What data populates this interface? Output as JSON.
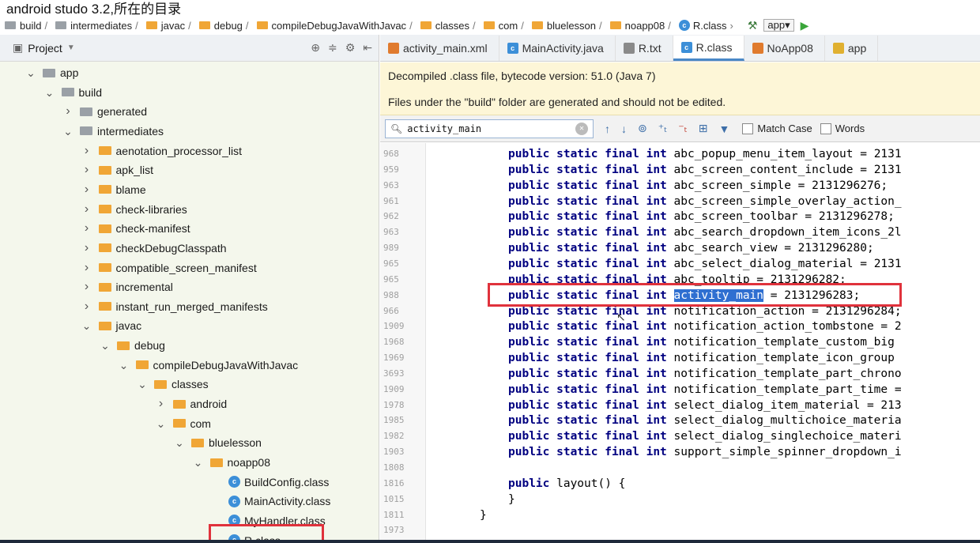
{
  "caption": "android studo 3.2,所在的目录",
  "breadcrumb": {
    "items": [
      {
        "label": "build",
        "color": "#9aa0a6"
      },
      {
        "label": "intermediates",
        "color": "#9aa0a6"
      },
      {
        "label": "javac",
        "color": "#f0a636"
      },
      {
        "label": "debug",
        "color": "#f0a636"
      },
      {
        "label": "compileDebugJavaWithJavac",
        "color": "#f0a636"
      },
      {
        "label": "classes",
        "color": "#f0a636"
      },
      {
        "label": "com",
        "color": "#f0a636"
      },
      {
        "label": "bluelesson",
        "color": "#f0a636"
      },
      {
        "label": "noapp08",
        "color": "#f0a636"
      }
    ],
    "file": "R.class",
    "run_config": "app"
  },
  "project": {
    "title": "Project",
    "tree": [
      {
        "label": "app",
        "depth": 0,
        "arrow": "down",
        "icon": "module"
      },
      {
        "label": "build",
        "depth": 1,
        "arrow": "down",
        "icon": "grey"
      },
      {
        "label": "generated",
        "depth": 2,
        "arrow": "right",
        "icon": "grey"
      },
      {
        "label": "intermediates",
        "depth": 2,
        "arrow": "down",
        "icon": "grey"
      },
      {
        "label": "aenotation_processor_list",
        "depth": 3,
        "arrow": "right",
        "icon": "orange"
      },
      {
        "label": "apk_list",
        "depth": 3,
        "arrow": "right",
        "icon": "orange"
      },
      {
        "label": "blame",
        "depth": 3,
        "arrow": "right",
        "icon": "orange"
      },
      {
        "label": "check-libraries",
        "depth": 3,
        "arrow": "right",
        "icon": "orange"
      },
      {
        "label": "check-manifest",
        "depth": 3,
        "arrow": "right",
        "icon": "orange"
      },
      {
        "label": "checkDebugClasspath",
        "depth": 3,
        "arrow": "right",
        "icon": "orange"
      },
      {
        "label": "compatible_screen_manifest",
        "depth": 3,
        "arrow": "right",
        "icon": "orange"
      },
      {
        "label": "incremental",
        "depth": 3,
        "arrow": "right",
        "icon": "orange"
      },
      {
        "label": "instant_run_merged_manifests",
        "depth": 3,
        "arrow": "right",
        "icon": "orange"
      },
      {
        "label": "javac",
        "depth": 3,
        "arrow": "down",
        "icon": "orange"
      },
      {
        "label": "debug",
        "depth": 4,
        "arrow": "down",
        "icon": "orange"
      },
      {
        "label": "compileDebugJavaWithJavac",
        "depth": 5,
        "arrow": "down",
        "icon": "orange"
      },
      {
        "label": "classes",
        "depth": 6,
        "arrow": "down",
        "icon": "orange"
      },
      {
        "label": "android",
        "depth": 7,
        "arrow": "right",
        "icon": "orange"
      },
      {
        "label": "com",
        "depth": 7,
        "arrow": "down",
        "icon": "orange"
      },
      {
        "label": "bluelesson",
        "depth": 8,
        "arrow": "down",
        "icon": "orange"
      },
      {
        "label": "noapp08",
        "depth": 9,
        "arrow": "down",
        "icon": "orange"
      },
      {
        "label": "BuildConfig.class",
        "depth": 10,
        "arrow": "",
        "icon": "class"
      },
      {
        "label": "MainActivity.class",
        "depth": 10,
        "arrow": "",
        "icon": "class"
      },
      {
        "label": "MyHandler.class",
        "depth": 10,
        "arrow": "",
        "icon": "class"
      },
      {
        "label": "R.class",
        "depth": 10,
        "arrow": "",
        "icon": "class"
      }
    ]
  },
  "tabs": [
    {
      "label": "activity_main.xml",
      "icon_color": "#e07b2e",
      "active": false
    },
    {
      "label": "MainActivity.java",
      "icon_color": "#3c8fd8",
      "active": false
    },
    {
      "label": "R.txt",
      "icon_color": "#8a8a8a",
      "active": false
    },
    {
      "label": "R.class",
      "icon_color": "#3c8fd8",
      "active": true
    },
    {
      "label": "NoApp08",
      "icon_color": "#e07b2e",
      "active": false
    },
    {
      "label": "app",
      "icon_color": "#e0b030",
      "active": false
    }
  ],
  "banners": [
    "Decompiled .class file, bytecode version: 51.0 (Java 7)",
    "Files under the \"build\" folder are generated and should not be edited."
  ],
  "search": {
    "value": "activity_main",
    "match_case_label": "Match Case",
    "words_label": "Words"
  },
  "code_lines": [
    {
      "ln": "968",
      "pre": "public static final int ",
      "name": "abc_popup_menu_item_layout",
      "post": " = 2131"
    },
    {
      "ln": "959",
      "pre": "public static final int ",
      "name": "abc_screen_content_include",
      "post": " = 2131"
    },
    {
      "ln": "963",
      "pre": "public static final int ",
      "name": "abc_screen_simple",
      "post": " = 2131296276;"
    },
    {
      "ln": "961",
      "pre": "public static final int ",
      "name": "abc_screen_simple_overlay_action_",
      "post": ""
    },
    {
      "ln": "962",
      "pre": "public static final int ",
      "name": "abc_screen_toolbar",
      "post": " = 2131296278;"
    },
    {
      "ln": "963",
      "pre": "public static final int ",
      "name": "abc_search_dropdown_item_icons_2l",
      "post": ""
    },
    {
      "ln": "989",
      "pre": "public static final int ",
      "name": "abc_search_view",
      "post": " = 2131296280;"
    },
    {
      "ln": "965",
      "pre": "public static final int ",
      "name": "abc_select_dialog_material",
      "post": " = 2131"
    },
    {
      "ln": "965",
      "pre": "public static final int ",
      "name": "abc_tooltip",
      "post": " = 2131296282;"
    },
    {
      "ln": "988",
      "pre": "public static final int ",
      "name": "activity_main",
      "post": " = 2131296283;",
      "highlight": true
    },
    {
      "ln": "966",
      "pre": "public static final int ",
      "name": "notification_action",
      "post": " = 2131296284;"
    },
    {
      "ln": "1909",
      "pre": "public static final int ",
      "name": "notification_action_tombstone",
      "post": " = 2"
    },
    {
      "ln": "1968",
      "pre": "public static final int ",
      "name": "notification_template_custom_big",
      "post": ""
    },
    {
      "ln": "1969",
      "pre": "public static final int ",
      "name": "notification_template_icon_group",
      "post": ""
    },
    {
      "ln": "3693",
      "pre": "public static final int ",
      "name": "notification_template_part_chrono",
      "post": ""
    },
    {
      "ln": "1909",
      "pre": "public static final int ",
      "name": "notification_template_part_time",
      "post": " ="
    },
    {
      "ln": "1978",
      "pre": "public static final int ",
      "name": "select_dialog_item_material",
      "post": " = 213"
    },
    {
      "ln": "1985",
      "pre": "public static final int ",
      "name": "select_dialog_multichoice_materia",
      "post": ""
    },
    {
      "ln": "1982",
      "pre": "public static final int ",
      "name": "select_dialog_singlechoice_materi",
      "post": ""
    },
    {
      "ln": "1903",
      "pre": "public static final int ",
      "name": "support_simple_spinner_dropdown_i",
      "post": ""
    },
    {
      "ln": "1808",
      "pre": "",
      "name": "",
      "post": ""
    },
    {
      "ln": "1816",
      "pre": "public ",
      "name": "layout() {",
      "post": ""
    },
    {
      "ln": "1015",
      "pre": "",
      "name": "}",
      "post": ""
    },
    {
      "ln": "1811",
      "pre": "",
      "name": "}",
      "post": ""
    },
    {
      "ln": "1973",
      "pre": "",
      "name": "",
      "post": ""
    }
  ]
}
